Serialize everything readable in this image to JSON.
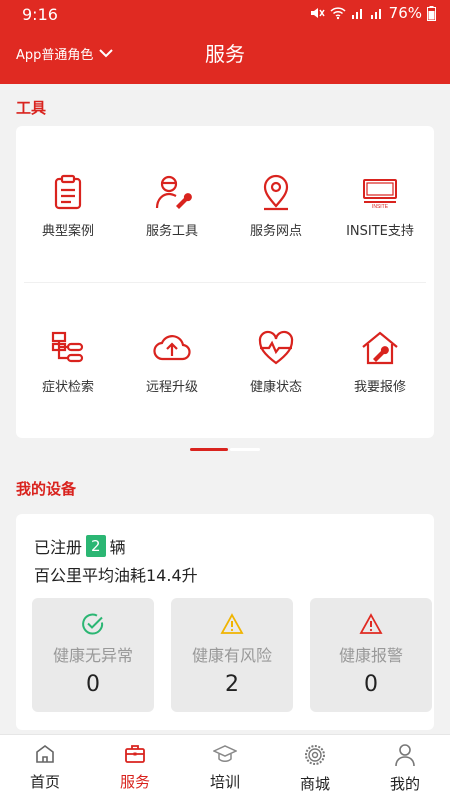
{
  "status_bar": {
    "time": "9:16",
    "battery": "76%"
  },
  "header": {
    "role": "App普通角色",
    "title": "服务"
  },
  "tools_section": {
    "title": "工具",
    "items": [
      {
        "label": "典型案例",
        "icon": "clipboard-icon"
      },
      {
        "label": "服务工具",
        "icon": "service-tool-icon"
      },
      {
        "label": "服务网点",
        "icon": "location-pin-icon"
      },
      {
        "label": "INSITE支持",
        "icon": "insite-icon"
      },
      {
        "label": "症状检索",
        "icon": "symptom-search-icon"
      },
      {
        "label": "远程升级",
        "icon": "cloud-upload-icon"
      },
      {
        "label": "健康状态",
        "icon": "heart-pulse-icon"
      },
      {
        "label": "我要报修",
        "icon": "house-repair-icon"
      }
    ],
    "insite_icon_text": "INSITE",
    "pager": {
      "pages": 2,
      "current": 1
    }
  },
  "devices_section": {
    "title": "我的设备",
    "registered_prefix": "已注册",
    "registered_count": "2",
    "registered_suffix": "辆",
    "fuel_text": "百公里平均油耗14.4升",
    "stats": [
      {
        "label": "健康无异常",
        "value": "0",
        "icon": "check-circle-icon",
        "color": "#2bb673"
      },
      {
        "label": "健康有风险",
        "value": "2",
        "icon": "warning-icon",
        "color": "#f0b400"
      },
      {
        "label": "健康报警",
        "value": "0",
        "icon": "alert-icon",
        "color": "#e02a22"
      }
    ]
  },
  "tab_bar": {
    "items": [
      {
        "label": "首页",
        "icon": "home-icon"
      },
      {
        "label": "服务",
        "icon": "briefcase-icon"
      },
      {
        "label": "培训",
        "icon": "graduation-cap-icon"
      },
      {
        "label": "商城",
        "icon": "mall-gear-icon"
      },
      {
        "label": "我的",
        "icon": "person-icon"
      }
    ],
    "active": "服务"
  },
  "colors": {
    "brand": "#e02a22",
    "accent_text": "#d9231e",
    "badge": "#2bb673"
  }
}
